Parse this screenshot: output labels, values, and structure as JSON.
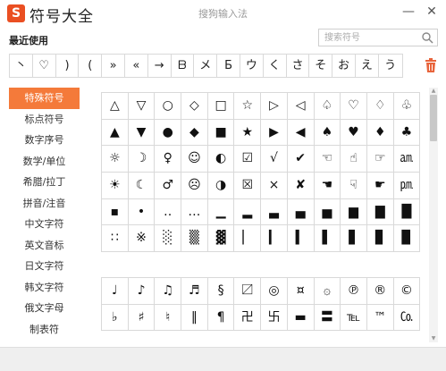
{
  "title_bar": {
    "logo_glyph": "S",
    "app_title": "符号大全",
    "center_title": "搜狗输入法",
    "minimize": "—",
    "close": "✕"
  },
  "recent": {
    "label": "最近使用",
    "symbols": [
      "丶",
      "♡",
      ")",
      "(",
      "»",
      "«",
      "→",
      "ᗷ",
      "メ",
      "Б",
      "ウ",
      "く",
      "さ",
      "そ",
      "お",
      "え",
      "う"
    ]
  },
  "search": {
    "placeholder": "搜索符号",
    "value": ""
  },
  "sidebar": {
    "active_index": 0,
    "items": [
      "特殊符号",
      "标点符号",
      "数字序号",
      "数学/单位",
      "希腊/拉丁",
      "拼音/注音",
      "中文字符",
      "英文音标",
      "日文字符",
      "韩文字符",
      "俄文字母",
      "制表符"
    ]
  },
  "symbol_grid": {
    "rows": [
      [
        "△",
        "▽",
        "○",
        "◇",
        "□",
        "☆",
        "▷",
        "◁",
        "♤",
        "♡",
        "♢",
        "♧"
      ],
      [
        "▲",
        "▼",
        "●",
        "◆",
        "■",
        "★",
        "▶",
        "◀",
        "♠",
        "♥",
        "♦",
        "♣"
      ],
      [
        "☼",
        "☽",
        "♀",
        "☺",
        "◐",
        "☑",
        "√",
        "✔",
        "☜",
        "☝",
        "☞",
        "㏂"
      ],
      [
        "☀",
        "☾",
        "♂",
        "☹",
        "◑",
        "☒",
        "×",
        "✘",
        "☚",
        "☟",
        "☛",
        "㏘"
      ],
      [
        "▪",
        "•",
        "‥",
        "…",
        "▁",
        "▂",
        "▃",
        "▄",
        "▅",
        "▆",
        "▇",
        "█"
      ],
      [
        "∷",
        "※",
        "░",
        "▒",
        "▓",
        "▏",
        "▎",
        "▍",
        "▌",
        "▋",
        "▊",
        "▉"
      ]
    ]
  },
  "symbol_grid_2": {
    "rows": [
      [
        "♩",
        "♪",
        "♫",
        "♬",
        "§",
        "〼",
        "◎",
        "¤",
        "۞",
        "℗",
        "®",
        "©"
      ],
      [
        "♭",
        "♯",
        "♮",
        "‖",
        "¶",
        "卍",
        "卐",
        "▬",
        "〓",
        "℡",
        "™",
        "㏇"
      ]
    ]
  },
  "colors": {
    "accent": "#f47a3a",
    "logo": "#ea4f22",
    "grid_line": "#d9d9d9",
    "trash": "#e8643c"
  },
  "icons": {
    "search": "search-icon",
    "trash": "trash-icon"
  }
}
